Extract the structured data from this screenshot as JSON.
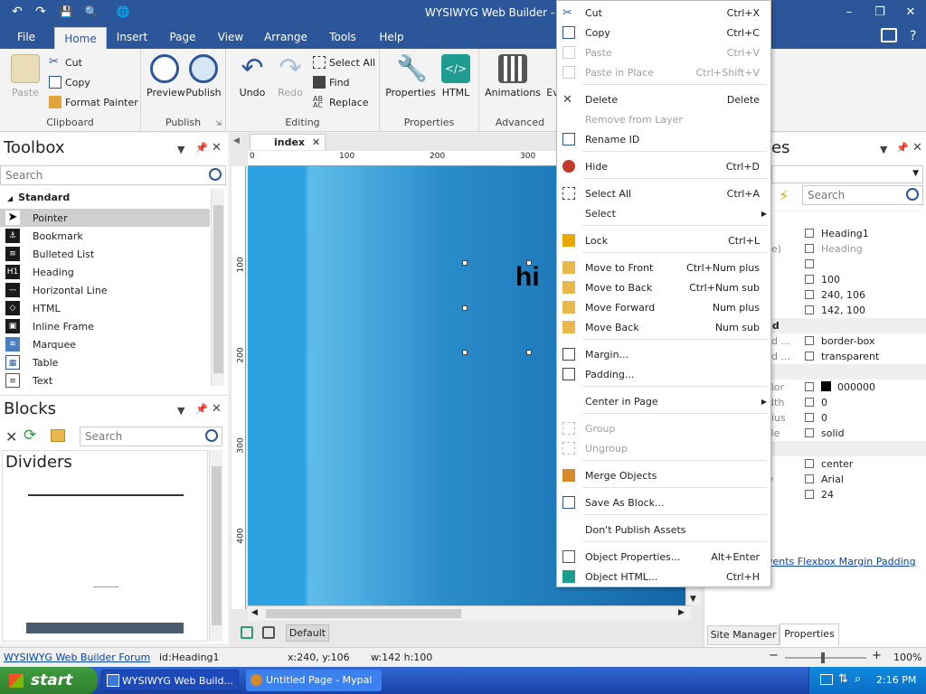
{
  "window": {
    "title": "WYSIWYG Web Builder - [Unt"
  },
  "quick_access": {
    "undo": "↶",
    "redo": "↷",
    "save": "💾",
    "preview": "🔍",
    "publish": "🌐"
  },
  "menu": {
    "tabs": [
      "File",
      "Home",
      "Insert",
      "Page",
      "View",
      "Arrange",
      "Tools",
      "Help"
    ]
  },
  "ribbon": {
    "paste": "Paste",
    "cut": "Cut",
    "copy": "Copy",
    "format_painter": "Format Painter",
    "clipboard": "Clipboard",
    "preview": "Preview",
    "publish_btn": "Publish",
    "publish": "Publish",
    "undo": "Undo",
    "redo": "Redo",
    "select_all": "Select All",
    "find": "Find",
    "replace": "Replace",
    "editing": "Editing",
    "properties_btn": "Properties",
    "html": "HTML",
    "properties": "Properties",
    "animations": "Animations",
    "events": "Ev",
    "advanced": "Advanced"
  },
  "toolbox": {
    "title": "Toolbox",
    "search_placeholder": "Search",
    "section": "Standard",
    "items": [
      "Pointer",
      "Bookmark",
      "Bulleted List",
      "Heading",
      "Horizontal Line",
      "HTML",
      "Inline Frame",
      "Marquee",
      "Table",
      "Text"
    ]
  },
  "blocks": {
    "title": "Blocks",
    "search_placeholder": "Search",
    "category": "Dividers"
  },
  "document": {
    "tab": "index",
    "ruler_h": [
      "0",
      "100",
      "200",
      "300"
    ],
    "ruler_v": [
      "100",
      "200",
      "300",
      "400"
    ],
    "heading_text": "hi",
    "layout_tab": "Default"
  },
  "context_menu": {
    "items": [
      {
        "label": "Cut",
        "key": "Ctrl+X",
        "disabled": false
      },
      {
        "label": "Copy",
        "key": "Ctrl+C",
        "disabled": false
      },
      {
        "label": "Paste",
        "key": "Ctrl+V",
        "disabled": true
      },
      {
        "label": "Paste in Place",
        "key": "Ctrl+Shift+V",
        "disabled": true
      },
      {
        "label": "Delete",
        "key": "Delete",
        "disabled": false
      },
      {
        "label": "Remove from Layer",
        "key": "",
        "disabled": true
      },
      {
        "label": "Rename ID",
        "key": "",
        "disabled": false
      },
      {
        "label": "Hide",
        "key": "Ctrl+D",
        "disabled": false
      },
      {
        "label": "Select All",
        "key": "Ctrl+A",
        "disabled": false
      },
      {
        "label": "Select",
        "key": "",
        "disabled": false
      },
      {
        "label": "Lock",
        "key": "Ctrl+L",
        "disabled": false
      },
      {
        "label": "Move to Front",
        "key": "Ctrl+Num plus",
        "disabled": false
      },
      {
        "label": "Move to Back",
        "key": "Ctrl+Num sub",
        "disabled": false
      },
      {
        "label": "Move Forward",
        "key": "Num plus",
        "disabled": false
      },
      {
        "label": "Move Back",
        "key": "Num sub",
        "disabled": false
      },
      {
        "label": "Margin...",
        "key": "",
        "disabled": false
      },
      {
        "label": "Padding...",
        "key": "",
        "disabled": false
      },
      {
        "label": "Center in Page",
        "key": "",
        "disabled": false
      },
      {
        "label": "Group",
        "key": "",
        "disabled": true
      },
      {
        "label": "Ungroup",
        "key": "",
        "disabled": true
      },
      {
        "label": "Merge Objects",
        "key": "",
        "disabled": false
      },
      {
        "label": "Save As Block...",
        "key": "",
        "disabled": false
      },
      {
        "label": "Don't Publish Assets",
        "key": "",
        "disabled": false
      },
      {
        "label": "Object Properties...",
        "key": "Alt+Enter",
        "disabled": false
      },
      {
        "label": "Object HTML...",
        "key": "Ctrl+H",
        "disabled": false
      }
    ]
  },
  "properties": {
    "title": "es",
    "search_placeholder": "Search",
    "rows": [
      {
        "key": "",
        "value": "Heading1"
      },
      {
        "key": "pe)",
        "value": "Heading"
      },
      {
        "key": "",
        "value": ""
      },
      {
        "key": "",
        "value": "100"
      },
      {
        "key": "",
        "value": "240, 106"
      },
      {
        "key": "",
        "value": "142, 100"
      },
      {
        "key": "nd ...",
        "value": "border-box"
      },
      {
        "key": "nd ...",
        "value": "transparent"
      },
      {
        "key": "olor",
        "value": "000000"
      },
      {
        "key": "idth",
        "value": "0"
      },
      {
        "key": "dius",
        "value": "0"
      },
      {
        "key": "yle",
        "value": "solid"
      },
      {
        "key": "t",
        "value": "center"
      },
      {
        "key": "ly",
        "value": "Arial"
      },
      {
        "key": "",
        "value": "24"
      }
    ],
    "section_1": "nd",
    "links": [
      "vents",
      "Flexbox",
      "Margin",
      "Padding"
    ],
    "bottom_tabs": [
      "Site Manager",
      "Properties"
    ]
  },
  "status": {
    "forum": "WYSIWYG Web Builder Forum",
    "id": "id:Heading1",
    "xy": "x:240, y:106",
    "wh": "w:142 h:100",
    "zoom": "100%"
  },
  "taskbar": {
    "start": "start",
    "tasks": [
      "WYSIWYG Web Build...",
      "Untitled Page - Mypal"
    ],
    "clock": "2:16 PM"
  },
  "colors": {
    "accent": "#2b579a",
    "taskbar": "#245edb",
    "start": "#3a9a3a"
  }
}
